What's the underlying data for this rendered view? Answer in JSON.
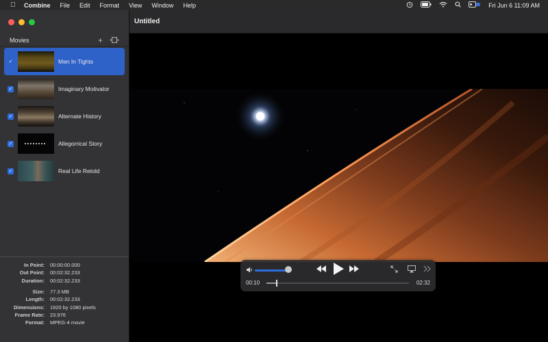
{
  "menubar": {
    "app": "Combine",
    "items": [
      "File",
      "Edit",
      "Format",
      "View",
      "Window",
      "Help"
    ],
    "clock": "Fri Jun 6  11:09 AM"
  },
  "window": {
    "title": "Untitled"
  },
  "sidebar": {
    "header": "Movies",
    "add_label": "+",
    "movies": [
      {
        "name": "Men In Tights",
        "checked": true,
        "selected": true
      },
      {
        "name": "Imaginary Motivator",
        "checked": true,
        "selected": false
      },
      {
        "name": "Alternate History",
        "checked": true,
        "selected": false
      },
      {
        "name": "Allegorrical Story",
        "checked": true,
        "selected": false
      },
      {
        "name": "Real Life Retold",
        "checked": true,
        "selected": false
      }
    ]
  },
  "info": {
    "in_point_label": "In Point:",
    "in_point": "00:00:00.000",
    "out_point_label": "Out Point:",
    "out_point": "00:02:32.233",
    "duration_label": "Duration:",
    "duration": "00:02:32.233",
    "size_label": "Size:",
    "size": "77.3 MB",
    "length_label": "Length:",
    "length": "00:02:32.233",
    "dimensions_label": "Dimensions:",
    "dimensions": "1920 by 1080 pixels",
    "frame_rate_label": "Frame Rate:",
    "frame_rate": "23.976",
    "format_label": "Format:",
    "format": "MPEG-4 movie"
  },
  "player": {
    "elapsed": "00:10",
    "remaining": "02:32",
    "volume_fraction": 0.95,
    "progress_fraction": 0.07
  },
  "colors": {
    "accent": "#2d6cdf",
    "selection": "#2f62c8"
  }
}
